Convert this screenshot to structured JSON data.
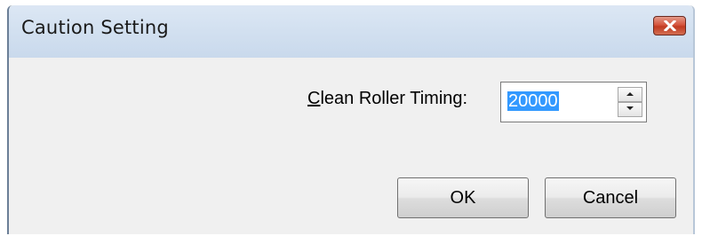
{
  "window": {
    "title": "Caution Setting"
  },
  "form": {
    "clean_roller_label_mnemonic": "C",
    "clean_roller_label_rest": "lean Roller Timing:",
    "clean_roller_value": "20000"
  },
  "buttons": {
    "ok_label": "OK",
    "cancel_label": "Cancel"
  },
  "icons": {
    "close": "close-icon",
    "spin_up": "arrow-up-icon",
    "spin_down": "arrow-down-icon"
  },
  "colors": {
    "close_button": "#c13a20",
    "selection": "#3399ff",
    "titlebar": "#d2e0f0"
  }
}
